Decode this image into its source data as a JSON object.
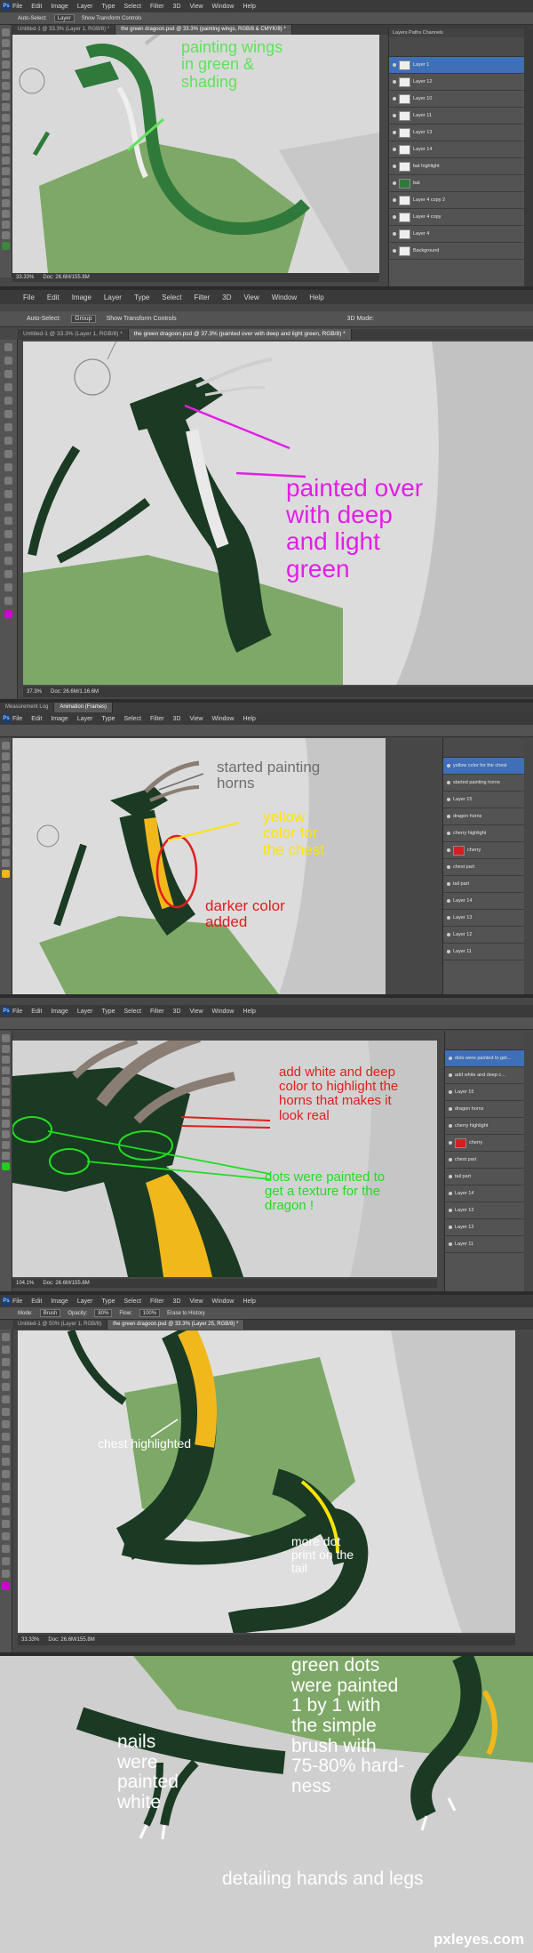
{
  "menus": [
    "File",
    "Edit",
    "Image",
    "Layer",
    "Type",
    "Select",
    "Filter",
    "3D",
    "View",
    "Window",
    "Help"
  ],
  "ps_logo": "Ps",
  "p1": {
    "options": [
      "Auto-Select:",
      "Layer",
      "Show Transform Controls"
    ],
    "tabs": [
      "Untitled-1 @ 33.3% (Layer 1, RGB/8) *",
      "the green dragoon.psd @ 33.3% (painting wings, RGB/8 & CMYK/8) *"
    ],
    "status": "33.33%",
    "status_doc": "Doc: 26.6M/155.8M",
    "annotation": "painting wings\nin green &\nshading",
    "layers_header": "Layers   Paths   Channels",
    "layers": [
      "Layer 1",
      "Layer 12",
      "Layer 10",
      "Layer 11",
      "Layer 13",
      "Layer 14",
      "bat highlight",
      "bat",
      "Layer 4 copy 2",
      "Layer 4 copy",
      "Layer 4",
      "Background"
    ]
  },
  "p2": {
    "options": [
      "Auto-Select:",
      "Group",
      "Show Transform Controls"
    ],
    "mode": "3D Mode:",
    "tabs": [
      "Untitled-1 @ 33.3% (Layer 1, RGB/8) *",
      "the green dragoon.psd @ 37.3% (painted over with deep and light green, RGB/8) *"
    ],
    "status": "37.3%",
    "status_doc": "Doc: 26.6M/1.16.6M",
    "annotation": "painted over\nwith deep\nand light\ngreen"
  },
  "p3": {
    "bottom_tabs": [
      "Measurement Log",
      "Animation (Frames)"
    ],
    "annotation_horns": "started painting\nhorns",
    "annotation_chest": "yellow\ncolor for\nthe chest",
    "annotation_darker": "darker color\nadded",
    "layers": [
      "yellow color for the chest",
      "started painting horns",
      "Layer 15",
      "dragon horns",
      "cherry highlight",
      "cherry",
      "chest part",
      "tail part",
      "Layer 14",
      "Layer 13",
      "Layer 12",
      "Layer 11"
    ]
  },
  "p4": {
    "annotation_horns": "add white and deep\ncolor to highlight the\nhorns that makes it\nlook real",
    "annotation_dots": "dots were painted to\nget a texture for the\ndragon !",
    "layers": [
      "dots were painted to get...",
      "add white and deep c...",
      "Layer 15",
      "dragon horns",
      "cherry highlight",
      "cherry",
      "chest part",
      "tail part",
      "Layer 14",
      "Layer 13",
      "Layer 12",
      "Layer 11"
    ],
    "status": "104.1%",
    "status_doc": "Doc: 26.6M/155.8M"
  },
  "p5": {
    "options": [
      "Mode:",
      "Brush",
      "Opacity:",
      "80%",
      "Flow:",
      "100%",
      "Erase to History"
    ],
    "tabs": [
      "Untitled-1 @ 50% (Layer 1, RGB/8)",
      "the green dragoon.psd @ 33.3% (Layer 25, RGB/8) *"
    ],
    "annotation_chest": "chest highlighted",
    "annotation_tail": "more dot\nprint on the\ntail",
    "status": "33.33%",
    "status_doc": "Doc: 26.6M/155.8M"
  },
  "p6": {
    "annotation_nails": "nails\nwere\npainted\nwhite",
    "annotation_dots": "green dots\nwere painted\n1 by 1 with\nthe simple\nbrush with\n75-80% hard-\nness",
    "annotation_detail": "detailing hands and legs",
    "watermark": "pxleyes.com"
  },
  "colors": {
    "green_ann": "#5ee35a",
    "magenta_ann": "#e21fe6",
    "yellow_ann": "#ffe400",
    "red_ann": "#e01e1e",
    "grey_ann": "#6e6e6e",
    "dragon_dark": "#1b3a23",
    "wing_green": "#7ea867",
    "chest_yellow": "#f1b81c"
  }
}
